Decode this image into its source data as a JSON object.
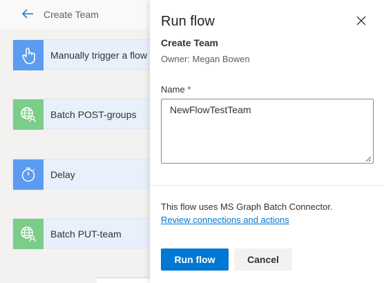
{
  "header": {
    "title": "Create Team"
  },
  "steps": [
    {
      "label": "Manually trigger a flow",
      "icon": "touch-hand-icon"
    },
    {
      "label": "Batch POST-groups",
      "icon": "globe-user-icon"
    },
    {
      "label": "Delay",
      "icon": "timer-icon"
    },
    {
      "label": "Batch PUT-team",
      "icon": "globe-user-icon"
    }
  ],
  "panel": {
    "title": "Run flow",
    "flow_name": "Create Team",
    "owner": "Owner: Megan Bowen",
    "name_label": "Name",
    "required_mark": "*",
    "name_value": "NewFlowTestTeam",
    "info": "This flow uses MS Graph Batch Connector.",
    "review_link": "Review connections and actions",
    "run_label": "Run flow",
    "cancel_label": "Cancel"
  },
  "colors": {
    "primary": "#0078d4",
    "trigger_icon_bg": "#5b9cf0",
    "connector_icon_bg": "#7ccc8a",
    "step_bg": "#e8f1fb"
  }
}
